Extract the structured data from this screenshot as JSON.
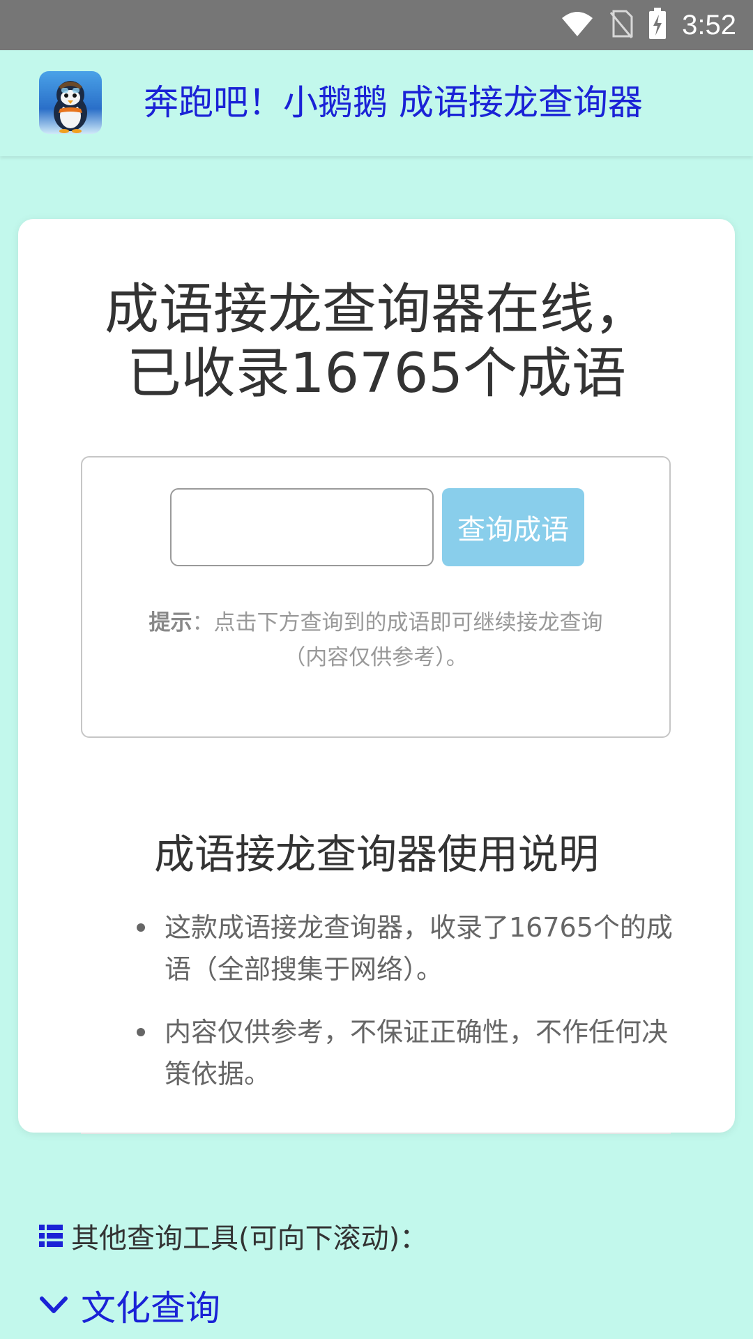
{
  "status_bar": {
    "time": "3:52",
    "icons": [
      "wifi-icon",
      "no-sim-icon",
      "battery-charging-icon"
    ]
  },
  "app": {
    "logo_icon": "penguin-logo",
    "title": "奔跑吧！小鹅鹅 成语接龙查询器"
  },
  "main": {
    "heading_line1": "成语接龙查询器在线，",
    "heading_line2": "已收录16765个成语",
    "search": {
      "input_value": "",
      "input_placeholder": "",
      "button_label": "查询成语",
      "hint_label": "提示",
      "hint_text": "：点击下方查询到的成语即可继续接龙查询",
      "hint_text2": "（内容仅供参考）。"
    },
    "usage": {
      "title": "成语接龙查询器使用说明",
      "items": [
        "这款成语接龙查询器，收录了16765个的成语（全部搜集于网络）。",
        "内容仅供参考，不保证正确性，不作任何决策依据。"
      ]
    }
  },
  "tools": {
    "label": "其他查询工具(可向下滚动)：",
    "category": "文化查询"
  },
  "colors": {
    "background": "#c2f8ec",
    "link_blue": "#1a22d6",
    "button": "#89ceeb",
    "status_bar": "#767676"
  }
}
